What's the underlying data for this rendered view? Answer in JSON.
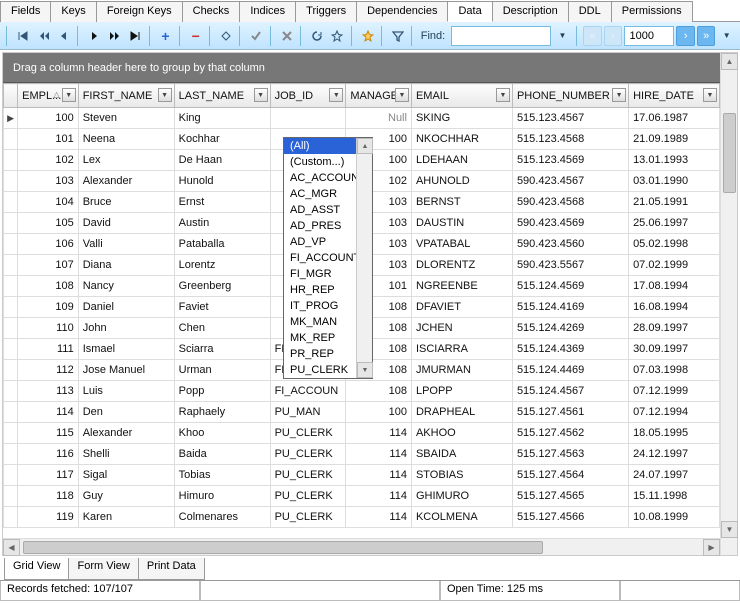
{
  "tabs": [
    "Fields",
    "Keys",
    "Foreign Keys",
    "Checks",
    "Indices",
    "Triggers",
    "Dependencies",
    "Data",
    "Description",
    "DDL",
    "Permissions"
  ],
  "active_tab": "Data",
  "toolbar": {
    "find_label": "Find:",
    "page_size": "1000"
  },
  "group_panel": "Drag a column header here to group by that column",
  "columns": [
    "EMPL...",
    "FIRST_NAME",
    "LAST_NAME",
    "JOB_ID",
    "MANAGE...",
    "EMAIL",
    "PHONE_NUMBER",
    "HIRE_DATE"
  ],
  "sort_col": 0,
  "rows": [
    {
      "emp": "100",
      "fn": "Steven",
      "ln": "King",
      "job": "",
      "mgr": "Null",
      "email": "SKING",
      "phone": "515.123.4567",
      "hire": "17.06.1987",
      "cur": true
    },
    {
      "emp": "101",
      "fn": "Neena",
      "ln": "Kochhar",
      "job": "",
      "mgr": "100",
      "email": "NKOCHHAR",
      "phone": "515.123.4568",
      "hire": "21.09.1989"
    },
    {
      "emp": "102",
      "fn": "Lex",
      "ln": "De Haan",
      "job": "",
      "mgr": "100",
      "email": "LDEHAAN",
      "phone": "515.123.4569",
      "hire": "13.01.1993"
    },
    {
      "emp": "103",
      "fn": "Alexander",
      "ln": "Hunold",
      "job": "",
      "mgr": "102",
      "email": "AHUNOLD",
      "phone": "590.423.4567",
      "hire": "03.01.1990"
    },
    {
      "emp": "104",
      "fn": "Bruce",
      "ln": "Ernst",
      "job": "",
      "mgr": "103",
      "email": "BERNST",
      "phone": "590.423.4568",
      "hire": "21.05.1991"
    },
    {
      "emp": "105",
      "fn": "David",
      "ln": "Austin",
      "job": "",
      "mgr": "103",
      "email": "DAUSTIN",
      "phone": "590.423.4569",
      "hire": "25.06.1997"
    },
    {
      "emp": "106",
      "fn": "Valli",
      "ln": "Pataballa",
      "job": "",
      "mgr": "103",
      "email": "VPATABAL",
      "phone": "590.423.4560",
      "hire": "05.02.1998"
    },
    {
      "emp": "107",
      "fn": "Diana",
      "ln": "Lorentz",
      "job": "",
      "mgr": "103",
      "email": "DLORENTZ",
      "phone": "590.423.5567",
      "hire": "07.02.1999"
    },
    {
      "emp": "108",
      "fn": "Nancy",
      "ln": "Greenberg",
      "job": "",
      "mgr": "101",
      "email": "NGREENBE",
      "phone": "515.124.4569",
      "hire": "17.08.1994"
    },
    {
      "emp": "109",
      "fn": "Daniel",
      "ln": "Faviet",
      "job": "",
      "mgr": "108",
      "email": "DFAVIET",
      "phone": "515.124.4169",
      "hire": "16.08.1994"
    },
    {
      "emp": "110",
      "fn": "John",
      "ln": "Chen",
      "job": "",
      "mgr": "108",
      "email": "JCHEN",
      "phone": "515.124.4269",
      "hire": "28.09.1997"
    },
    {
      "emp": "111",
      "fn": "Ismael",
      "ln": "Sciarra",
      "job": "FI_ACCOUN",
      "mgr": "108",
      "email": "ISCIARRA",
      "phone": "515.124.4369",
      "hire": "30.09.1997"
    },
    {
      "emp": "112",
      "fn": "Jose Manuel",
      "ln": "Urman",
      "job": "FI_ACCOUN",
      "mgr": "108",
      "email": "JMURMAN",
      "phone": "515.124.4469",
      "hire": "07.03.1998"
    },
    {
      "emp": "113",
      "fn": "Luis",
      "ln": "Popp",
      "job": "FI_ACCOUN",
      "mgr": "108",
      "email": "LPOPP",
      "phone": "515.124.4567",
      "hire": "07.12.1999"
    },
    {
      "emp": "114",
      "fn": "Den",
      "ln": "Raphaely",
      "job": "PU_MAN",
      "mgr": "100",
      "email": "DRAPHEAL",
      "phone": "515.127.4561",
      "hire": "07.12.1994"
    },
    {
      "emp": "115",
      "fn": "Alexander",
      "ln": "Khoo",
      "job": "PU_CLERK",
      "mgr": "114",
      "email": "AKHOO",
      "phone": "515.127.4562",
      "hire": "18.05.1995"
    },
    {
      "emp": "116",
      "fn": "Shelli",
      "ln": "Baida",
      "job": "PU_CLERK",
      "mgr": "114",
      "email": "SBAIDA",
      "phone": "515.127.4563",
      "hire": "24.12.1997"
    },
    {
      "emp": "117",
      "fn": "Sigal",
      "ln": "Tobias",
      "job": "PU_CLERK",
      "mgr": "114",
      "email": "STOBIAS",
      "phone": "515.127.4564",
      "hire": "24.07.1997"
    },
    {
      "emp": "118",
      "fn": "Guy",
      "ln": "Himuro",
      "job": "PU_CLERK",
      "mgr": "114",
      "email": "GHIMURO",
      "phone": "515.127.4565",
      "hire": "15.11.1998"
    },
    {
      "emp": "119",
      "fn": "Karen",
      "ln": "Colmenares",
      "job": "PU_CLERK",
      "mgr": "114",
      "email": "KCOLMENA",
      "phone": "515.127.4566",
      "hire": "10.08.1999"
    }
  ],
  "filter_dropdown": {
    "items": [
      "(All)",
      "(Custom...)",
      "AC_ACCOUNT",
      "AC_MGR",
      "AD_ASST",
      "AD_PRES",
      "AD_VP",
      "FI_ACCOUNT",
      "FI_MGR",
      "HR_REP",
      "IT_PROG",
      "MK_MAN",
      "MK_REP",
      "PR_REP",
      "PU_CLERK"
    ],
    "selected": 0
  },
  "bottom_tabs": [
    "Grid View",
    "Form View",
    "Print Data"
  ],
  "active_bottom": "Grid View",
  "status": {
    "records": "Records fetched: 107/107",
    "open_time": "Open Time: 125 ms"
  }
}
